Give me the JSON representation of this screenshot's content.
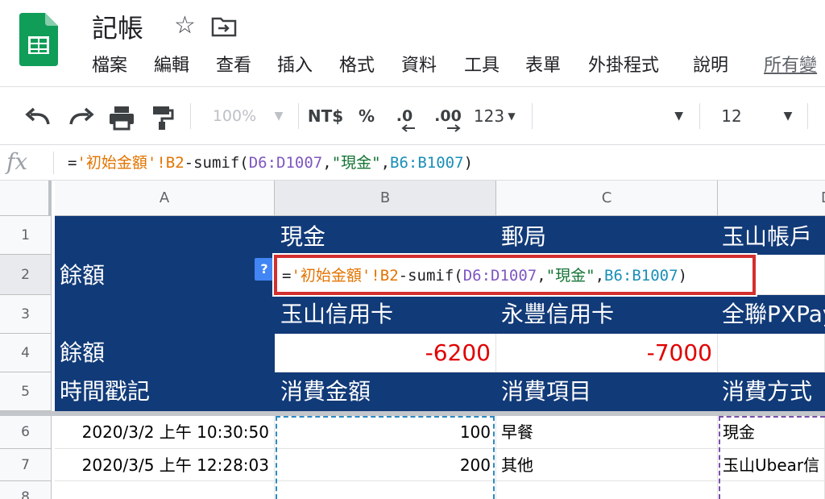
{
  "app": {
    "title": "記帳",
    "star_icon": "star-outline-icon",
    "move_icon": "move-to-folder-icon"
  },
  "menu": [
    "檔案",
    "編輯",
    "查看",
    "插入",
    "格式",
    "資料",
    "工具",
    "表單",
    "外掛程式",
    "說明",
    "所有變"
  ],
  "toolbar": {
    "zoom": "100%",
    "currency": "NT$",
    "percent": "%",
    "decrease_decimal": ".0",
    "increase_decimal": ".00",
    "more_formats": "123",
    "font_size": "12"
  },
  "formula_bar": {
    "fx": "fx",
    "formula": {
      "eq": "=",
      "ref1": "'初始金額'!B2",
      "op": "-sumif(",
      "range1": "D6:D1007",
      "comma1": ",",
      "criterion": "\"現金\"",
      "comma2": ",",
      "range2": "B6:B1007",
      "close": ")"
    }
  },
  "columns": [
    "A",
    "B",
    "C",
    "D"
  ],
  "rows": [
    "1",
    "2",
    "3",
    "4",
    "5",
    "6",
    "7",
    "8"
  ],
  "cells": {
    "b1": "現金",
    "c1": "郵局",
    "d1": "玉山帳戶",
    "a2": "餘額",
    "b3": "玉山信用卡",
    "c3": "永豐信用卡",
    "d3": "全聯PXPay",
    "a4": "餘額",
    "b4": "-6200",
    "c4": "-7000",
    "a5": "時間戳記",
    "b5": "消費金額",
    "c5": "消費項目",
    "d5": "消費方式"
  },
  "data_rows": [
    {
      "a": "2020/3/2 上午 10:30:50",
      "b": "100",
      "c": "早餐",
      "d": "現金"
    },
    {
      "a": "2020/3/5 上午 12:28:03",
      "b": "200",
      "c": "其他",
      "d": "玉山Ubear信"
    }
  ],
  "help_badge": "?",
  "colors": {
    "header_fill": "#113a78",
    "negative": "#e00000",
    "edit_border": "#d32f2f",
    "sheets_green": "#0f9d58"
  }
}
